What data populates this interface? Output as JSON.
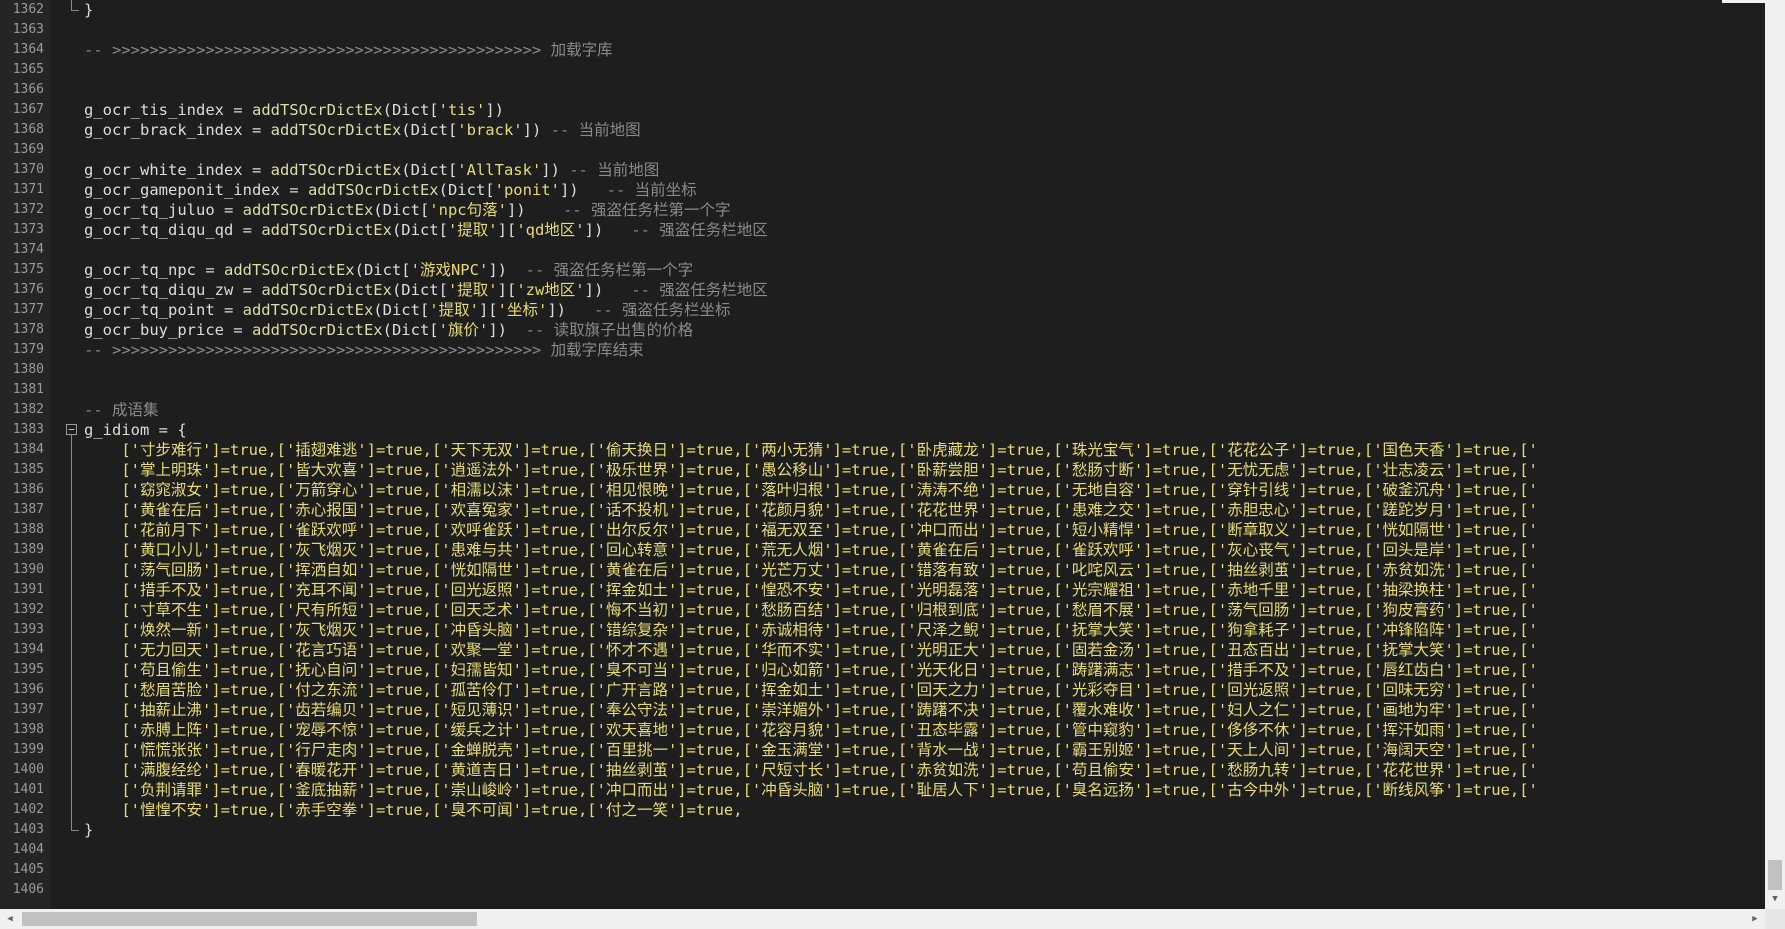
{
  "editor": {
    "lines": [
      {
        "n": "1362",
        "t": [
          [
            "id",
            "}"
          ]
        ]
      },
      {
        "n": "1363",
        "t": []
      },
      {
        "n": "1364",
        "t": [
          [
            "com",
            "-- >>>>>>>>>>>>>>>>>>>>>>>>>>>>>>>>>>>>>>>>>>>>>> 加载字库"
          ]
        ]
      },
      {
        "n": "1365",
        "t": []
      },
      {
        "n": "1366",
        "t": []
      },
      {
        "n": "1367",
        "t": [
          [
            "id",
            "g_ocr_tis_index = "
          ],
          [
            "fn",
            "addTSOcrDictEx"
          ],
          [
            "id",
            "(Dict["
          ],
          [
            "str",
            "'tis'"
          ],
          [
            "id",
            "])"
          ]
        ]
      },
      {
        "n": "1368",
        "t": [
          [
            "id",
            "g_ocr_brack_index = "
          ],
          [
            "fn",
            "addTSOcrDictEx"
          ],
          [
            "id",
            "(Dict["
          ],
          [
            "str",
            "'brack'"
          ],
          [
            "id",
            "]) "
          ],
          [
            "com",
            "-- 当前地图"
          ]
        ]
      },
      {
        "n": "1369",
        "t": []
      },
      {
        "n": "1370",
        "t": [
          [
            "id",
            "g_ocr_white_index = "
          ],
          [
            "fn",
            "addTSOcrDictEx"
          ],
          [
            "id",
            "(Dict["
          ],
          [
            "str",
            "'AllTask'"
          ],
          [
            "id",
            "]) "
          ],
          [
            "com",
            "-- 当前地图"
          ]
        ]
      },
      {
        "n": "1371",
        "t": [
          [
            "id",
            "g_ocr_gameponit_index = "
          ],
          [
            "fn",
            "addTSOcrDictEx"
          ],
          [
            "id",
            "(Dict["
          ],
          [
            "str",
            "'ponit'"
          ],
          [
            "id",
            "])   "
          ],
          [
            "com",
            "-- 当前坐标"
          ]
        ]
      },
      {
        "n": "1372",
        "t": [
          [
            "id",
            "g_ocr_tq_juluo = "
          ],
          [
            "fn",
            "addTSOcrDictEx"
          ],
          [
            "id",
            "(Dict["
          ],
          [
            "str",
            "'npc句落'"
          ],
          [
            "id",
            "])    "
          ],
          [
            "com",
            "-- 强盗任务栏第一个字"
          ]
        ]
      },
      {
        "n": "1373",
        "t": [
          [
            "id",
            "g_ocr_tq_diqu_qd = "
          ],
          [
            "fn",
            "addTSOcrDictEx"
          ],
          [
            "id",
            "(Dict["
          ],
          [
            "str",
            "'提取'"
          ],
          [
            "id",
            "]["
          ],
          [
            "str",
            "'qd地区'"
          ],
          [
            "id",
            "])   "
          ],
          [
            "com",
            "-- 强盗任务栏地区"
          ]
        ]
      },
      {
        "n": "1374",
        "t": []
      },
      {
        "n": "1375",
        "t": [
          [
            "id",
            "g_ocr_tq_npc = "
          ],
          [
            "fn",
            "addTSOcrDictEx"
          ],
          [
            "id",
            "(Dict["
          ],
          [
            "str",
            "'游戏NPC'"
          ],
          [
            "id",
            "])  "
          ],
          [
            "com",
            "-- 强盗任务栏第一个字"
          ]
        ]
      },
      {
        "n": "1376",
        "t": [
          [
            "id",
            "g_ocr_tq_diqu_zw = "
          ],
          [
            "fn",
            "addTSOcrDictEx"
          ],
          [
            "id",
            "(Dict["
          ],
          [
            "str",
            "'提取'"
          ],
          [
            "id",
            "]["
          ],
          [
            "str",
            "'zw地区'"
          ],
          [
            "id",
            "])   "
          ],
          [
            "com",
            "-- 强盗任务栏地区"
          ]
        ]
      },
      {
        "n": "1377",
        "t": [
          [
            "id",
            "g_ocr_tq_point = "
          ],
          [
            "fn",
            "addTSOcrDictEx"
          ],
          [
            "id",
            "(Dict["
          ],
          [
            "str",
            "'提取'"
          ],
          [
            "id",
            "]["
          ],
          [
            "str",
            "'坐标'"
          ],
          [
            "id",
            "])   "
          ],
          [
            "com",
            "-- 强盗任务栏坐标"
          ]
        ]
      },
      {
        "n": "1378",
        "t": [
          [
            "id",
            "g_ocr_buy_price = "
          ],
          [
            "fn",
            "addTSOcrDictEx"
          ],
          [
            "id",
            "(Dict["
          ],
          [
            "str",
            "'旗价'"
          ],
          [
            "id",
            "])  "
          ],
          [
            "com",
            "-- 读取旗子出售的价格"
          ]
        ]
      },
      {
        "n": "1379",
        "t": [
          [
            "com",
            "-- >>>>>>>>>>>>>>>>>>>>>>>>>>>>>>>>>>>>>>>>>>>>>> 加载字库结束"
          ]
        ]
      },
      {
        "n": "1380",
        "t": []
      },
      {
        "n": "1381",
        "t": []
      },
      {
        "n": "1382",
        "t": [
          [
            "com",
            "-- 成语集"
          ]
        ]
      },
      {
        "n": "1383",
        "t": [
          [
            "id",
            "g_idiom = {"
          ]
        ]
      },
      {
        "n": "1384",
        "t": [
          [
            "str",
            "    ['寸步难行']=true,['插翅难逃']=true,['天下无双']=true,['偷天换日']=true,['两小无猜']=true,['卧虎藏龙']=true,['珠光宝气']=true,['花花公子']=true,['国色天香']=true,['"
          ]
        ]
      },
      {
        "n": "1385",
        "t": [
          [
            "str",
            "    ['掌上明珠']=true,['皆大欢喜']=true,['逍遥法外']=true,['极乐世界']=true,['愚公移山']=true,['卧薪尝胆']=true,['愁肠寸断']=true,['无忧无虑']=true,['壮志凌云']=true,['"
          ]
        ]
      },
      {
        "n": "1386",
        "t": [
          [
            "str",
            "    ['窈窕淑女']=true,['万箭穿心']=true,['相濡以沫']=true,['相见恨晚']=true,['落叶归根']=true,['涛涛不绝']=true,['无地自容']=true,['穿针引线']=true,['破釜沉舟']=true,['"
          ]
        ]
      },
      {
        "n": "1387",
        "t": [
          [
            "str",
            "    ['黄雀在后']=true,['赤心报国']=true,['欢喜冤家']=true,['话不投机']=true,['花颜月貌']=true,['花花世界']=true,['患难之交']=true,['赤胆忠心']=true,['蹉跎岁月']=true,['"
          ]
        ]
      },
      {
        "n": "1388",
        "t": [
          [
            "str",
            "    ['花前月下']=true,['雀跃欢呼']=true,['欢呼雀跃']=true,['出尔反尔']=true,['福无双至']=true,['冲口而出']=true,['短小精悍']=true,['断章取义']=true,['恍如隔世']=true,['"
          ]
        ]
      },
      {
        "n": "1389",
        "t": [
          [
            "str",
            "    ['黄口小儿']=true,['灰飞烟灭']=true,['患难与共']=true,['回心转意']=true,['荒无人烟']=true,['黄雀在后']=true,['雀跃欢呼']=true,['灰心丧气']=true,['回头是岸']=true,['"
          ]
        ]
      },
      {
        "n": "1390",
        "t": [
          [
            "str",
            "    ['荡气回肠']=true,['挥洒自如']=true,['恍如隔世']=true,['黄雀在后']=true,['光芒万丈']=true,['错落有致']=true,['叱咤风云']=true,['抽丝剥茧']=true,['赤贫如洗']=true,['"
          ]
        ]
      },
      {
        "n": "1391",
        "t": [
          [
            "str",
            "    ['措手不及']=true,['充耳不闻']=true,['回光返照']=true,['挥金如土']=true,['惶恐不安']=true,['光明磊落']=true,['光宗耀祖']=true,['赤地千里']=true,['抽梁换柱']=true,['"
          ]
        ]
      },
      {
        "n": "1392",
        "t": [
          [
            "str",
            "    ['寸草不生']=true,['尺有所短']=true,['回天乏术']=true,['悔不当初']=true,['愁肠百结']=true,['归根到底']=true,['愁眉不展']=true,['荡气回肠']=true,['狗皮膏药']=true,['"
          ]
        ]
      },
      {
        "n": "1393",
        "t": [
          [
            "str",
            "    ['焕然一新']=true,['灰飞烟灭']=true,['冲昏头脑']=true,['错综复杂']=true,['赤诚相待']=true,['尺泽之鲵']=true,['抚掌大笑']=true,['狗拿耗子']=true,['冲锋陷阵']=true,['"
          ]
        ]
      },
      {
        "n": "1394",
        "t": [
          [
            "str",
            "    ['无力回天']=true,['花言巧语']=true,['欢聚一堂']=true,['怀才不遇']=true,['华而不实']=true,['光明正大']=true,['固若金汤']=true,['丑态百出']=true,['抚掌大笑']=true,['"
          ]
        ]
      },
      {
        "n": "1395",
        "t": [
          [
            "str",
            "    ['苟且偷生']=true,['抚心自问']=true,['妇孺皆知']=true,['臭不可当']=true,['归心如箭']=true,['光天化日']=true,['踌躇满志']=true,['措手不及']=true,['唇红齿白']=true,['"
          ]
        ]
      },
      {
        "n": "1396",
        "t": [
          [
            "str",
            "    ['愁眉苦脸']=true,['付之东流']=true,['孤苦伶仃']=true,['广开言路']=true,['挥金如土']=true,['回天之力']=true,['光彩夺目']=true,['回光返照']=true,['回味无穷']=true,['"
          ]
        ]
      },
      {
        "n": "1397",
        "t": [
          [
            "str",
            "    ['抽薪止沸']=true,['齿若编贝']=true,['短见薄识']=true,['奉公守法']=true,['崇洋媚外']=true,['踌躇不决']=true,['覆水难收']=true,['妇人之仁']=true,['画地为牢']=true,['"
          ]
        ]
      },
      {
        "n": "1398",
        "t": [
          [
            "str",
            "    ['赤膊上阵']=true,['宠辱不惊']=true,['缓兵之计']=true,['欢天喜地']=true,['花容月貌']=true,['丑态毕露']=true,['管中窥豹']=true,['侈侈不休']=true,['挥汗如雨']=true,['"
          ]
        ]
      },
      {
        "n": "1399",
        "t": [
          [
            "str",
            "    ['慌慌张张']=true,['行尸走肉']=true,['金蝉脱壳']=true,['百里挑一']=true,['金玉满堂']=true,['背水一战']=true,['霸王别姬']=true,['天上人间']=true,['海阔天空']=true,['"
          ]
        ]
      },
      {
        "n": "1400",
        "t": [
          [
            "str",
            "    ['满腹经纶']=true,['春暖花开']=true,['黄道吉日']=true,['抽丝剥茧']=true,['尺短寸长']=true,['赤贫如洗']=true,['苟且偷安']=true,['愁肠九转']=true,['花花世界']=true,['"
          ]
        ]
      },
      {
        "n": "1401",
        "t": [
          [
            "str",
            "    ['负荆请罪']=true,['釜底抽薪']=true,['崇山峻岭']=true,['冲口而出']=true,['冲昏头脑']=true,['耻居人下']=true,['臭名远扬']=true,['古今中外']=true,['断线风筝']=true,['"
          ]
        ]
      },
      {
        "n": "1402",
        "t": [
          [
            "str",
            "    ['惶惶不安']=true,['赤手空拳']=true,['臭不可闻']=true,['付之一笑']=true,"
          ]
        ]
      },
      {
        "n": "1403",
        "t": [
          [
            "id",
            "}"
          ]
        ]
      },
      {
        "n": "1404",
        "t": []
      },
      {
        "n": "1405",
        "t": []
      },
      {
        "n": "1406",
        "t": []
      }
    ]
  },
  "scrollbars": {
    "down_arrow": "▼",
    "left_arrow": "◀",
    "right_arrow": "▶"
  }
}
